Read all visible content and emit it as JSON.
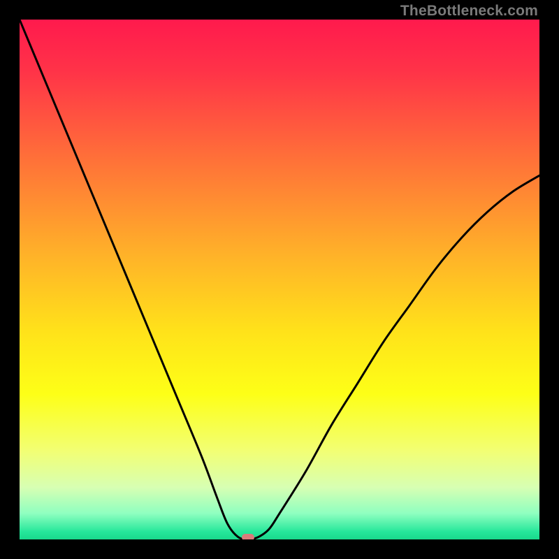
{
  "watermark": "TheBottleneck.com",
  "chart_data": {
    "type": "line",
    "title": "",
    "xlabel": "",
    "ylabel": "",
    "xlim": [
      0,
      100
    ],
    "ylim": [
      0,
      100
    ],
    "grid": false,
    "series": [
      {
        "name": "bottleneck-curve",
        "color": "#000000",
        "x": [
          0,
          5,
          10,
          15,
          20,
          25,
          30,
          35,
          38,
          40,
          42,
          44,
          46,
          48,
          50,
          55,
          60,
          65,
          70,
          75,
          80,
          85,
          90,
          95,
          100
        ],
        "y": [
          100,
          88,
          76,
          64,
          52,
          40,
          28,
          16,
          8,
          3,
          0.5,
          0,
          0.5,
          2,
          5,
          13,
          22,
          30,
          38,
          45,
          52,
          58,
          63,
          67,
          70
        ]
      }
    ],
    "marker": {
      "name": "optimal-point",
      "x": 44,
      "y": 0,
      "color": "#d97b7b"
    },
    "background_gradient": {
      "stops": [
        {
          "pos": 0.0,
          "color": "#ff1a4d"
        },
        {
          "pos": 0.1,
          "color": "#ff3348"
        },
        {
          "pos": 0.25,
          "color": "#ff6a3a"
        },
        {
          "pos": 0.45,
          "color": "#ffb129"
        },
        {
          "pos": 0.6,
          "color": "#ffe21a"
        },
        {
          "pos": 0.72,
          "color": "#fdff17"
        },
        {
          "pos": 0.83,
          "color": "#f2ff74"
        },
        {
          "pos": 0.9,
          "color": "#d7ffb3"
        },
        {
          "pos": 0.95,
          "color": "#8fffc0"
        },
        {
          "pos": 0.985,
          "color": "#26e79b"
        },
        {
          "pos": 1.0,
          "color": "#19d98c"
        }
      ]
    }
  }
}
